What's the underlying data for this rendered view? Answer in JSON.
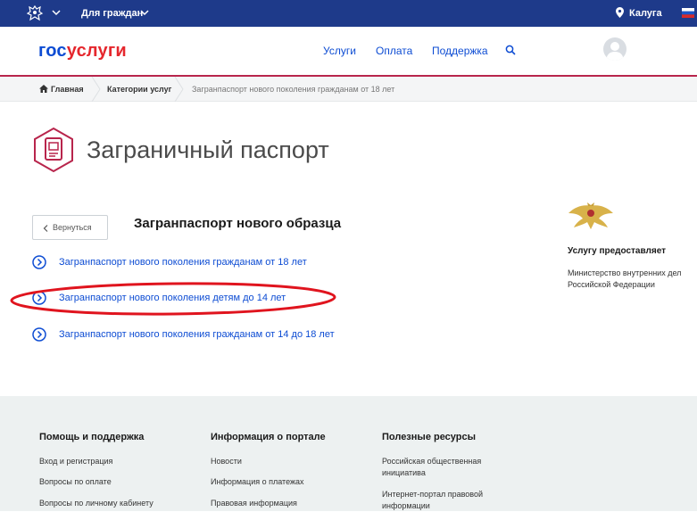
{
  "topbar": {
    "for_citizens": "Для граждан",
    "city": "Калуга"
  },
  "header": {
    "logo_part1": "гос",
    "logo_part2": "услуги",
    "nav": [
      "Услуги",
      "Оплата",
      "Поддержка"
    ]
  },
  "breadcrumbs": [
    "Главная",
    "Категории услуг",
    "Загранпаспорт нового поколения гражданам от 18 лет"
  ],
  "page": {
    "title": "Заграничный паспорт",
    "back_label": "Вернуться",
    "subtitle": "Загранпаспорт нового образца",
    "links": [
      "Загранпаспорт нового поколения гражданам от 18 лет",
      "Загранпаспорт нового поколения детям до 14 лет",
      "Загранпаспорт нового поколения гражданам от 14 до 18 лет"
    ]
  },
  "provider": {
    "label": "Услугу предоставляет",
    "line1": "Министерство внутренних дел",
    "line2": "Российской Федерации"
  },
  "footer": {
    "col1": {
      "title": "Помощь и поддержка",
      "items": [
        "Вход и регистрация",
        "Вопросы по оплате",
        "Вопросы по личному кабинету"
      ]
    },
    "col2": {
      "title": "Информация о портале",
      "items": [
        "Новости",
        "Информация о платежах",
        "Правовая информация"
      ]
    },
    "col3": {
      "title": "Полезные ресурсы",
      "items": [
        "Российская общественная",
        "инициатива",
        "Интернет-портал правовой",
        "информации"
      ]
    }
  },
  "colors": {
    "brand_blue": "#0d4cd3",
    "brand_red": "#e5272d",
    "topbar": "#1e3a8a",
    "accent": "#b8254c"
  }
}
